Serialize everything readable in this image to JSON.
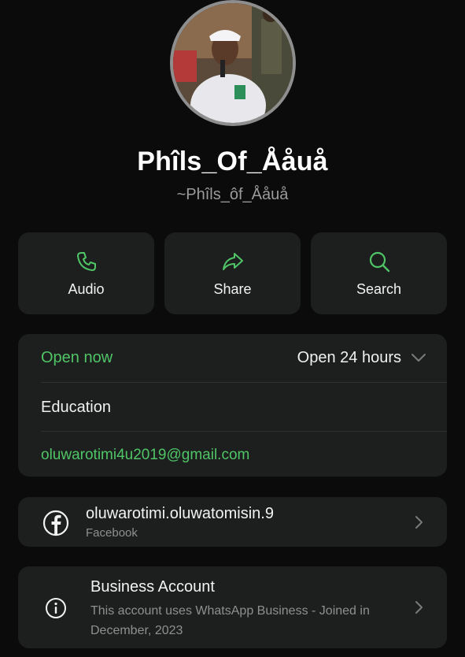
{
  "profile": {
    "name": "Phîls_Of_Ååuå",
    "handle": "~Phîls_ôf_Ååuå"
  },
  "actions": [
    {
      "label": "Audio",
      "icon": "phone-icon"
    },
    {
      "label": "Share",
      "icon": "share-arrow-icon"
    },
    {
      "label": "Search",
      "icon": "search-icon"
    }
  ],
  "business_info": {
    "open_status": "Open now",
    "hours": "Open 24 hours",
    "category": "Education",
    "email": "oluwarotimi4u2019@gmail.com"
  },
  "facebook": {
    "username": "oluwarotimi.oluwatomisin.9",
    "label": "Facebook",
    "icon": "facebook-icon"
  },
  "business_account": {
    "title": "Business Account",
    "description": "This account uses WhatsApp Business - Joined in December, 2023",
    "icon": "info-icon"
  },
  "colors": {
    "background": "#0b0b0b",
    "card": "#1d1f1f",
    "accent_green": "#4fc566",
    "muted_text": "#8f8f8f"
  }
}
